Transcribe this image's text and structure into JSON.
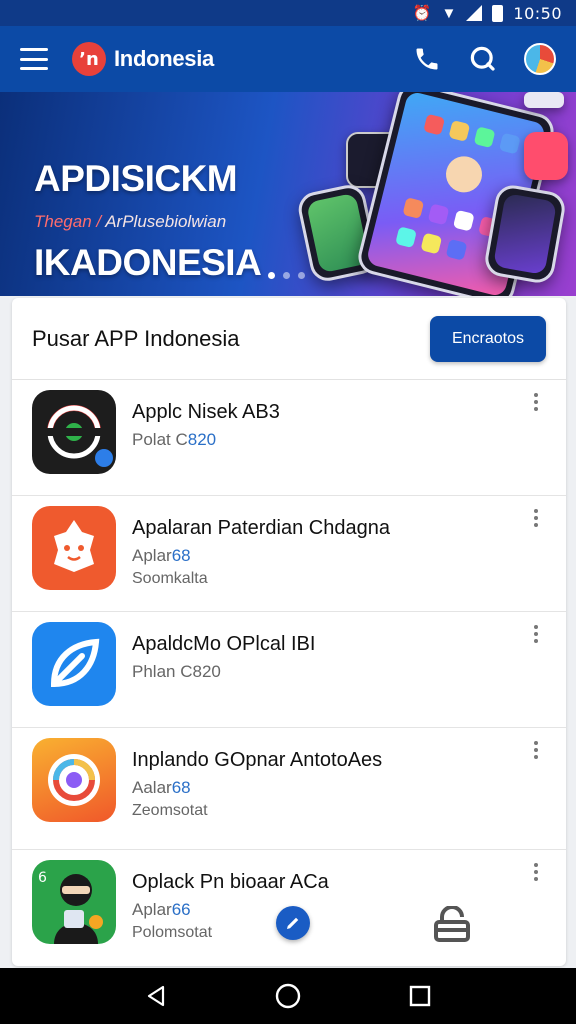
{
  "status_bar": {
    "time": "10:50"
  },
  "app_bar": {
    "title": "Indonesia",
    "brand_glyph": "ʼn"
  },
  "banner": {
    "title_line1": "APDISICKM",
    "title_line2": "IKADONESIA",
    "subtitle_a": "Thegan",
    "subtitle_sep": " / ",
    "subtitle_b": "ArPlusebiolwian",
    "slides": 3,
    "active_slide": 1
  },
  "card": {
    "title": "Pusar APP Indonesia",
    "button_label": "Encraotos"
  },
  "apps": [
    {
      "name": "Applc Nisek AB3",
      "meta_a": "Polat C",
      "meta_b": "820",
      "meta2": "",
      "icon": "ring-icon",
      "icon_bg": "#1d1d1d"
    },
    {
      "name": "Apalaran Paterdian Chdagna",
      "meta_a": "Aplar",
      "meta_b": "68",
      "meta2": "Soomkalta",
      "icon": "mascot-icon",
      "icon_bg": "#ef5a2e"
    },
    {
      "name": "ApaldcMo OPlcal IBI",
      "meta_a": "Phlan C",
      "meta_b": "820",
      "meta2": "",
      "icon": "leaf-icon",
      "icon_bg": "#1f86ee"
    },
    {
      "name": "Inplando GOpnar AntotoAes",
      "meta_a": "Aalar",
      "meta_b": "68",
      "meta2": "Zeomsotat",
      "icon": "flower-icon",
      "icon_bg": "#f48a22"
    },
    {
      "name": "Oplack Pn bioaar ACa",
      "meta_a": "Aplar",
      "meta_b": "66",
      "meta2": "Polomsotat",
      "icon": "ninja-icon",
      "icon_bg": "#2ba34a"
    }
  ],
  "colors": {
    "primary": "#0c4aa6",
    "status_bar": "#0f3a88",
    "accent_red": "#e8413a"
  }
}
